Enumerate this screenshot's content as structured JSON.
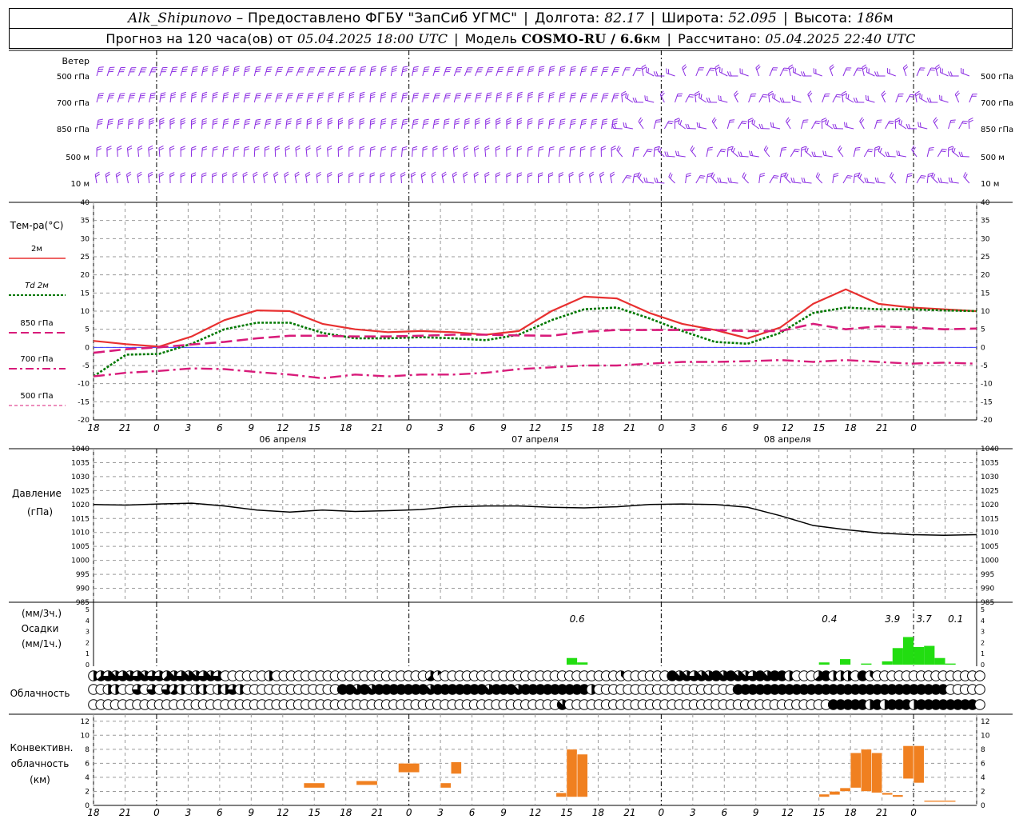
{
  "header": {
    "station": "Alk_Shipunovo",
    "provider": "– Предоставлено ФГБУ \"ЗапСиб УГМС\"",
    "lon_label": "Долгота:",
    "lon_value": "82.17",
    "lat_label": "Широта:",
    "lat_value": "52.095",
    "alt_label": "Высота:",
    "alt_value": "186",
    "alt_unit": "м",
    "forecast_prefix": "Прогноз на 120 часа(ов) от",
    "forecast_start": "05.04.2025 18:00 UTC",
    "model_label": "Модель",
    "model_name": "COSMO-RU / 6.6",
    "model_unit": "км",
    "computed_label": "Рассчитано:",
    "computed_time": "05.04.2025 22:40 UTC"
  },
  "labels": {
    "wind": "Ветер",
    "wind_levels": [
      "500 гПа",
      "700 гПа",
      "850 гПа",
      "500 м",
      "10 м"
    ],
    "temp_title": "Тем-ра(°C)",
    "temp_legend": [
      {
        "label": "2м",
        "prefix": ""
      },
      {
        "label": "2м",
        "prefix": "Td"
      },
      {
        "label": "850 гПа",
        "prefix": ""
      },
      {
        "label": "700 гПа",
        "prefix": ""
      },
      {
        "label": "500 гПа",
        "prefix": ""
      }
    ],
    "pressure_title_1": "Давление",
    "pressure_title_2": "(гПа)",
    "precip_unit_1": "(мм/3ч.)",
    "precip_title": "Осадки",
    "precip_unit_2": "(мм/1ч.)",
    "cloud_title": "Облачность",
    "conv_title_1": "Конвективн.",
    "conv_title_2": "облачность",
    "conv_title_3": "(км)"
  },
  "colors": {
    "wind": "#8a2be2",
    "t2m": "#e83030",
    "td2m": "#007800",
    "t850": "#d81b7a",
    "t700": "#d81b7a",
    "t500": "#d81b7a",
    "pressure": "#000000",
    "precip": "#22dd11",
    "conv": "#f08020",
    "zero_line": "#3a3aff"
  },
  "time_axis": {
    "hour_labels": [
      "18",
      "21",
      "0",
      "3",
      "6",
      "9",
      "12",
      "15",
      "18",
      "21",
      "0",
      "3",
      "6",
      "9",
      "12",
      "15",
      "18",
      "21",
      "0",
      "3",
      "6",
      "9",
      "12",
      "15",
      "18",
      "21",
      "0"
    ],
    "date_labels": [
      "06 апреля",
      "07 апреля",
      "08 апреля"
    ]
  },
  "chart_data": [
    {
      "type": "line",
      "title": "Тем-ра(°C)",
      "x_hours": [
        0,
        3,
        6,
        9,
        12,
        15,
        18,
        21,
        24,
        27,
        30,
        33,
        36,
        39,
        42,
        45,
        48,
        51,
        54,
        57,
        60,
        63,
        66,
        69,
        72,
        75,
        78
      ],
      "ylim": [
        -20,
        40
      ],
      "yticks": [
        -20,
        -15,
        -10,
        -5,
        0,
        5,
        10,
        15,
        20,
        25,
        30,
        35,
        40
      ],
      "series": [
        {
          "name": "2м",
          "values": [
            1.8,
            0.9,
            0.2,
            3.0,
            7.5,
            10.2,
            10.0,
            6.5,
            5.0,
            4.2,
            4.5,
            4.2,
            3.5,
            4.5,
            10.0,
            14.0,
            13.5,
            9.5,
            6.5,
            4.8,
            2.5,
            5.5,
            12.0,
            16.0,
            12.0,
            11.0,
            10.5,
            10.0
          ]
        },
        {
          "name": "Td 2м",
          "values": [
            -8.0,
            -2.0,
            -1.8,
            1.0,
            5.0,
            6.8,
            6.8,
            4.0,
            2.5,
            2.5,
            2.8,
            2.5,
            2.0,
            3.5,
            7.5,
            10.5,
            11.0,
            8.0,
            4.5,
            1.5,
            1.0,
            4.0,
            9.5,
            11.0,
            10.5,
            10.5,
            10.2,
            10.0
          ]
        },
        {
          "name": "850 гПа",
          "values": [
            -1.5,
            -0.5,
            0.0,
            0.8,
            1.5,
            2.5,
            3.2,
            3.2,
            3.0,
            3.0,
            3.2,
            3.5,
            3.5,
            3.3,
            3.2,
            4.3,
            4.8,
            4.8,
            4.8,
            4.8,
            4.5,
            4.5,
            6.5,
            5.0,
            5.8,
            5.5,
            5.0,
            5.2
          ]
        },
        {
          "name": "700 гПа",
          "values": [
            -8.0,
            -7.0,
            -6.5,
            -5.8,
            -6.0,
            -6.8,
            -7.5,
            -8.5,
            -7.5,
            -8.0,
            -7.5,
            -7.5,
            -7.0,
            -6.0,
            -5.5,
            -5.0,
            -5.0,
            -4.5,
            -4.0,
            -4.0,
            -3.8,
            -3.5,
            -4.0,
            -3.5,
            -4.0,
            -4.5,
            -4.2,
            -4.5
          ]
        }
      ]
    },
    {
      "type": "line",
      "title": "Давление",
      "ylabel": "(гПа)",
      "ylim": [
        985,
        1040
      ],
      "yticks": [
        985,
        990,
        995,
        1000,
        1005,
        1010,
        1015,
        1020,
        1025,
        1030,
        1035,
        1040
      ],
      "x_hours": [
        0,
        3,
        6,
        9,
        12,
        15,
        18,
        21,
        24,
        27,
        30,
        33,
        36,
        39,
        42,
        45,
        48,
        51,
        54,
        57,
        60,
        63,
        66,
        69,
        72,
        75,
        78
      ],
      "series": [
        {
          "name": "Давление",
          "values": [
            1020.0,
            1019.8,
            1020.2,
            1020.5,
            1019.5,
            1018.0,
            1017.3,
            1018.0,
            1017.5,
            1017.8,
            1018.2,
            1019.2,
            1019.5,
            1019.5,
            1019.0,
            1018.8,
            1019.2,
            1020.0,
            1020.2,
            1020.0,
            1019.0,
            1016.0,
            1012.5,
            1011.0,
            1009.8,
            1009.2,
            1009.0,
            1009.2
          ]
        }
      ]
    },
    {
      "type": "bar",
      "title": "Осадки",
      "ylim": [
        0,
        5
      ],
      "yticks": [
        0,
        1,
        2,
        3,
        4,
        5
      ],
      "bars_hourly": [
        {
          "h": 45,
          "v": 0.6
        },
        {
          "h": 46,
          "v": 0.2
        },
        {
          "h": 69,
          "v": 0.2
        },
        {
          "h": 71,
          "v": 0.5
        },
        {
          "h": 73,
          "v": 0.1
        },
        {
          "h": 75,
          "v": 0.3
        },
        {
          "h": 76,
          "v": 1.5
        },
        {
          "h": 77,
          "v": 2.5
        },
        {
          "h": 78,
          "v": 1.6
        },
        {
          "h": 79,
          "v": 1.7
        },
        {
          "h": 80,
          "v": 0.6
        },
        {
          "h": 81,
          "v": 0.1
        }
      ],
      "totals_3h": [
        {
          "h": 46,
          "text": "0.6"
        },
        {
          "h": 70,
          "text": "0.4"
        },
        {
          "h": 76,
          "text": "3.9"
        },
        {
          "h": 79,
          "text": "3.7"
        },
        {
          "h": 82,
          "text": "0.1"
        }
      ]
    },
    {
      "type": "bar",
      "title": "Конвективн. облачность",
      "ylabel": "(км)",
      "ylim": [
        0,
        13
      ],
      "yticks": [
        0,
        2,
        4,
        6,
        8,
        10,
        12
      ],
      "bars": [
        {
          "h0": 20.0,
          "h1": 22.0,
          "base": 2.5,
          "top": 3.2
        },
        {
          "h0": 25.0,
          "h1": 27.0,
          "base": 2.9,
          "top": 3.5
        },
        {
          "h0": 29.0,
          "h1": 31.0,
          "base": 4.7,
          "top": 6.0
        },
        {
          "h0": 33.0,
          "h1": 34.0,
          "base": 2.5,
          "top": 3.2
        },
        {
          "h0": 34.0,
          "h1": 35.0,
          "base": 4.5,
          "top": 6.2
        },
        {
          "h0": 44.0,
          "h1": 45.0,
          "base": 1.2,
          "top": 1.8
        },
        {
          "h0": 45.0,
          "h1": 46.0,
          "base": 1.2,
          "top": 8.0
        },
        {
          "h0": 46.0,
          "h1": 47.0,
          "base": 1.2,
          "top": 7.3
        },
        {
          "h0": 69.0,
          "h1": 70.0,
          "base": 1.2,
          "top": 1.6
        },
        {
          "h0": 70.0,
          "h1": 71.0,
          "base": 1.5,
          "top": 2.0
        },
        {
          "h0": 71.0,
          "h1": 72.0,
          "base": 2.0,
          "top": 2.5
        },
        {
          "h0": 72.0,
          "h1": 73.0,
          "base": 2.5,
          "top": 7.5
        },
        {
          "h0": 73.0,
          "h1": 74.0,
          "base": 2.0,
          "top": 8.0
        },
        {
          "h0": 74.0,
          "h1": 75.0,
          "base": 1.8,
          "top": 7.5
        },
        {
          "h0": 75.0,
          "h1": 76.0,
          "base": 1.5,
          "top": 1.8
        },
        {
          "h0": 76.0,
          "h1": 77.0,
          "base": 1.2,
          "top": 1.5
        },
        {
          "h0": 77.0,
          "h1": 78.0,
          "base": 3.8,
          "top": 8.5
        },
        {
          "h0": 78.0,
          "h1": 79.0,
          "base": 3.2,
          "top": 8.5
        },
        {
          "h0": 79.0,
          "h1": 82.0,
          "base": 0.5,
          "top": 0.7
        }
      ]
    },
    {
      "type": "table",
      "title": "Облачность",
      "rows_cover_octas": [
        [
          4,
          5,
          6,
          7,
          6,
          7,
          6,
          7,
          6,
          6,
          5,
          7,
          6,
          7,
          7,
          6,
          7,
          6,
          0,
          0,
          0,
          0,
          0,
          0,
          4,
          0,
          0,
          0,
          0,
          0,
          0,
          0,
          0,
          0,
          0,
          0,
          0,
          0,
          0,
          0,
          0,
          0,
          0,
          0,
          0,
          0,
          5,
          1,
          0,
          0,
          0,
          0,
          0,
          0,
          0,
          0,
          0,
          0,
          0,
          0,
          0,
          0,
          0,
          0,
          0,
          0,
          0,
          0,
          0,
          0,
          0,
          0,
          3,
          0,
          0,
          0,
          0,
          0,
          0,
          8,
          7,
          7,
          6,
          7,
          7,
          8,
          7,
          8,
          7,
          7,
          6,
          8,
          7,
          8,
          8,
          4,
          0,
          0,
          0,
          5,
          8,
          4,
          4,
          4,
          0,
          8,
          3,
          0,
          0,
          0,
          0,
          0,
          0,
          0,
          0,
          0,
          0,
          0,
          0,
          0,
          0
        ],
        [
          0,
          0,
          4,
          4,
          0,
          0,
          6,
          0,
          6,
          0,
          6,
          5,
          4,
          0,
          4,
          4,
          0,
          4,
          4,
          6,
          4,
          0,
          0,
          0,
          0,
          0,
          0,
          0,
          0,
          0,
          0,
          0,
          0,
          0,
          8,
          8,
          7,
          8,
          7,
          8,
          8,
          8,
          8,
          8,
          8,
          8,
          7,
          8,
          8,
          8,
          8,
          8,
          8,
          8,
          7,
          8,
          8,
          8,
          7,
          8,
          8,
          8,
          8,
          8,
          8,
          8,
          8,
          8,
          4,
          0,
          0,
          0,
          0,
          0,
          0,
          0,
          0,
          0,
          0,
          0,
          0,
          0,
          0,
          0,
          0,
          0,
          0,
          0,
          8,
          8,
          8,
          8,
          8,
          8,
          8,
          8,
          8,
          8,
          8,
          8,
          8,
          8,
          8,
          8,
          8,
          8,
          8,
          8,
          8,
          8,
          8,
          8,
          8,
          8,
          8,
          8,
          8
        ],
        [
          0,
          0,
          0,
          0,
          0,
          0,
          0,
          0,
          0,
          0,
          0,
          0,
          0,
          0,
          0,
          0,
          0,
          0,
          0,
          0,
          0,
          0,
          0,
          0,
          0,
          0,
          0,
          0,
          0,
          0,
          0,
          0,
          0,
          0,
          0,
          0,
          0,
          0,
          0,
          0,
          0,
          0,
          0,
          0,
          0,
          0,
          0,
          0,
          0,
          0,
          0,
          0,
          0,
          0,
          0,
          0,
          0,
          0,
          0,
          0,
          0,
          0,
          0,
          0,
          7,
          0,
          0,
          0,
          0,
          0,
          0,
          0,
          0,
          0,
          0,
          0,
          0,
          0,
          0,
          0,
          0,
          0,
          0,
          0,
          0,
          0,
          0,
          0,
          0,
          0,
          0,
          0,
          0,
          0,
          0,
          0,
          0,
          0,
          0,
          0,
          0,
          8,
          8,
          8,
          8,
          8,
          4,
          8,
          4,
          8,
          8,
          8,
          4,
          8,
          8,
          8,
          8,
          8,
          8,
          8,
          8
        ]
      ]
    }
  ]
}
